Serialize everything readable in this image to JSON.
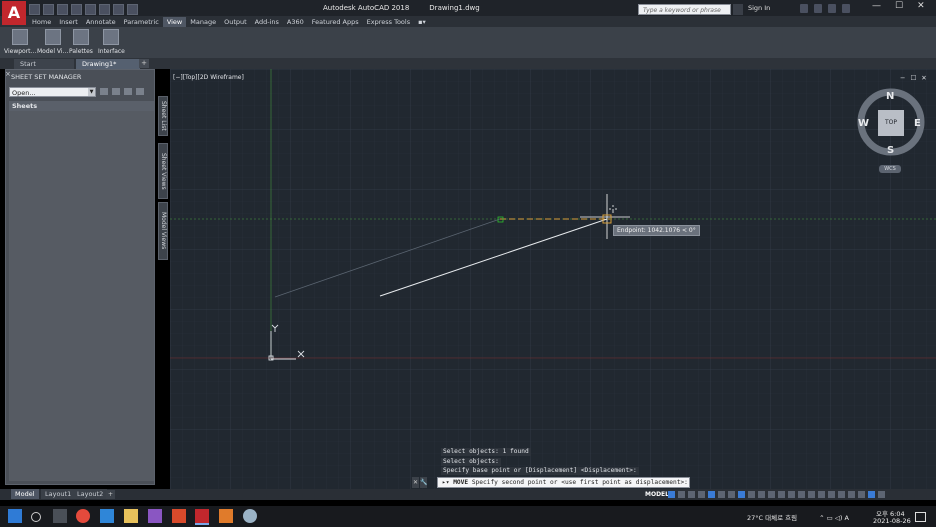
{
  "app": {
    "logo_letter": "A",
    "title": "Autodesk AutoCAD 2018",
    "document": "Drawing1.dwg",
    "search_placeholder": "Type a keyword or phrase",
    "signin_label": "Sign In",
    "window_controls": [
      "—",
      "☐",
      "✕"
    ]
  },
  "ribbon": {
    "tabs": [
      "Home",
      "Insert",
      "Annotate",
      "Parametric",
      "View",
      "Manage",
      "Output",
      "Add-ins",
      "A360",
      "Featured Apps",
      "Express Tools"
    ],
    "active_tab": "View",
    "buttons": [
      "Viewport...",
      "Model Vi...",
      "Palettes",
      "Interface"
    ]
  },
  "doc_tabs": {
    "items": [
      "Start",
      "Drawing1*"
    ],
    "active": "Drawing1*",
    "add": "+"
  },
  "sheet_set_manager": {
    "title": "SHEET SET MANAGER",
    "dropdown_value": "Open...",
    "section": "Sheets",
    "side_tabs": [
      "Sheet List",
      "Sheet Views",
      "Model Views"
    ]
  },
  "viewport": {
    "label": "[−][Top][2D Wireframe]",
    "window_buttons": [
      "−",
      "☐",
      "✕"
    ],
    "viewcube": {
      "top": "TOP",
      "north": "N",
      "south": "S",
      "east": "E",
      "west": "W",
      "wcs": "WCS"
    },
    "tooltip": "Endpoint: 1042.1076 < 0°",
    "ucs_y": "Y",
    "ucs_x": "X"
  },
  "command": {
    "history": [
      "Select objects: 1 found",
      "Select objects:",
      "Specify base point or [Displacement] <Displacement>:"
    ],
    "prompt_keyword": "MOVE",
    "prompt": "Specify second point or <use first point as displacement>:"
  },
  "layout_tabs": {
    "items": [
      "Model",
      "Layout1",
      "Layout2"
    ],
    "active": "Model",
    "add": "+"
  },
  "status": {
    "model_label": "MODEL"
  },
  "taskbar": {
    "weather": "27°C  대체로 흐림",
    "lang": "A",
    "time": "오후 6:04",
    "date": "2021-08-26"
  },
  "colors": {
    "accent": "#c1272d",
    "viewport_bg": "#212830",
    "active_blue": "#3a7bd5"
  }
}
